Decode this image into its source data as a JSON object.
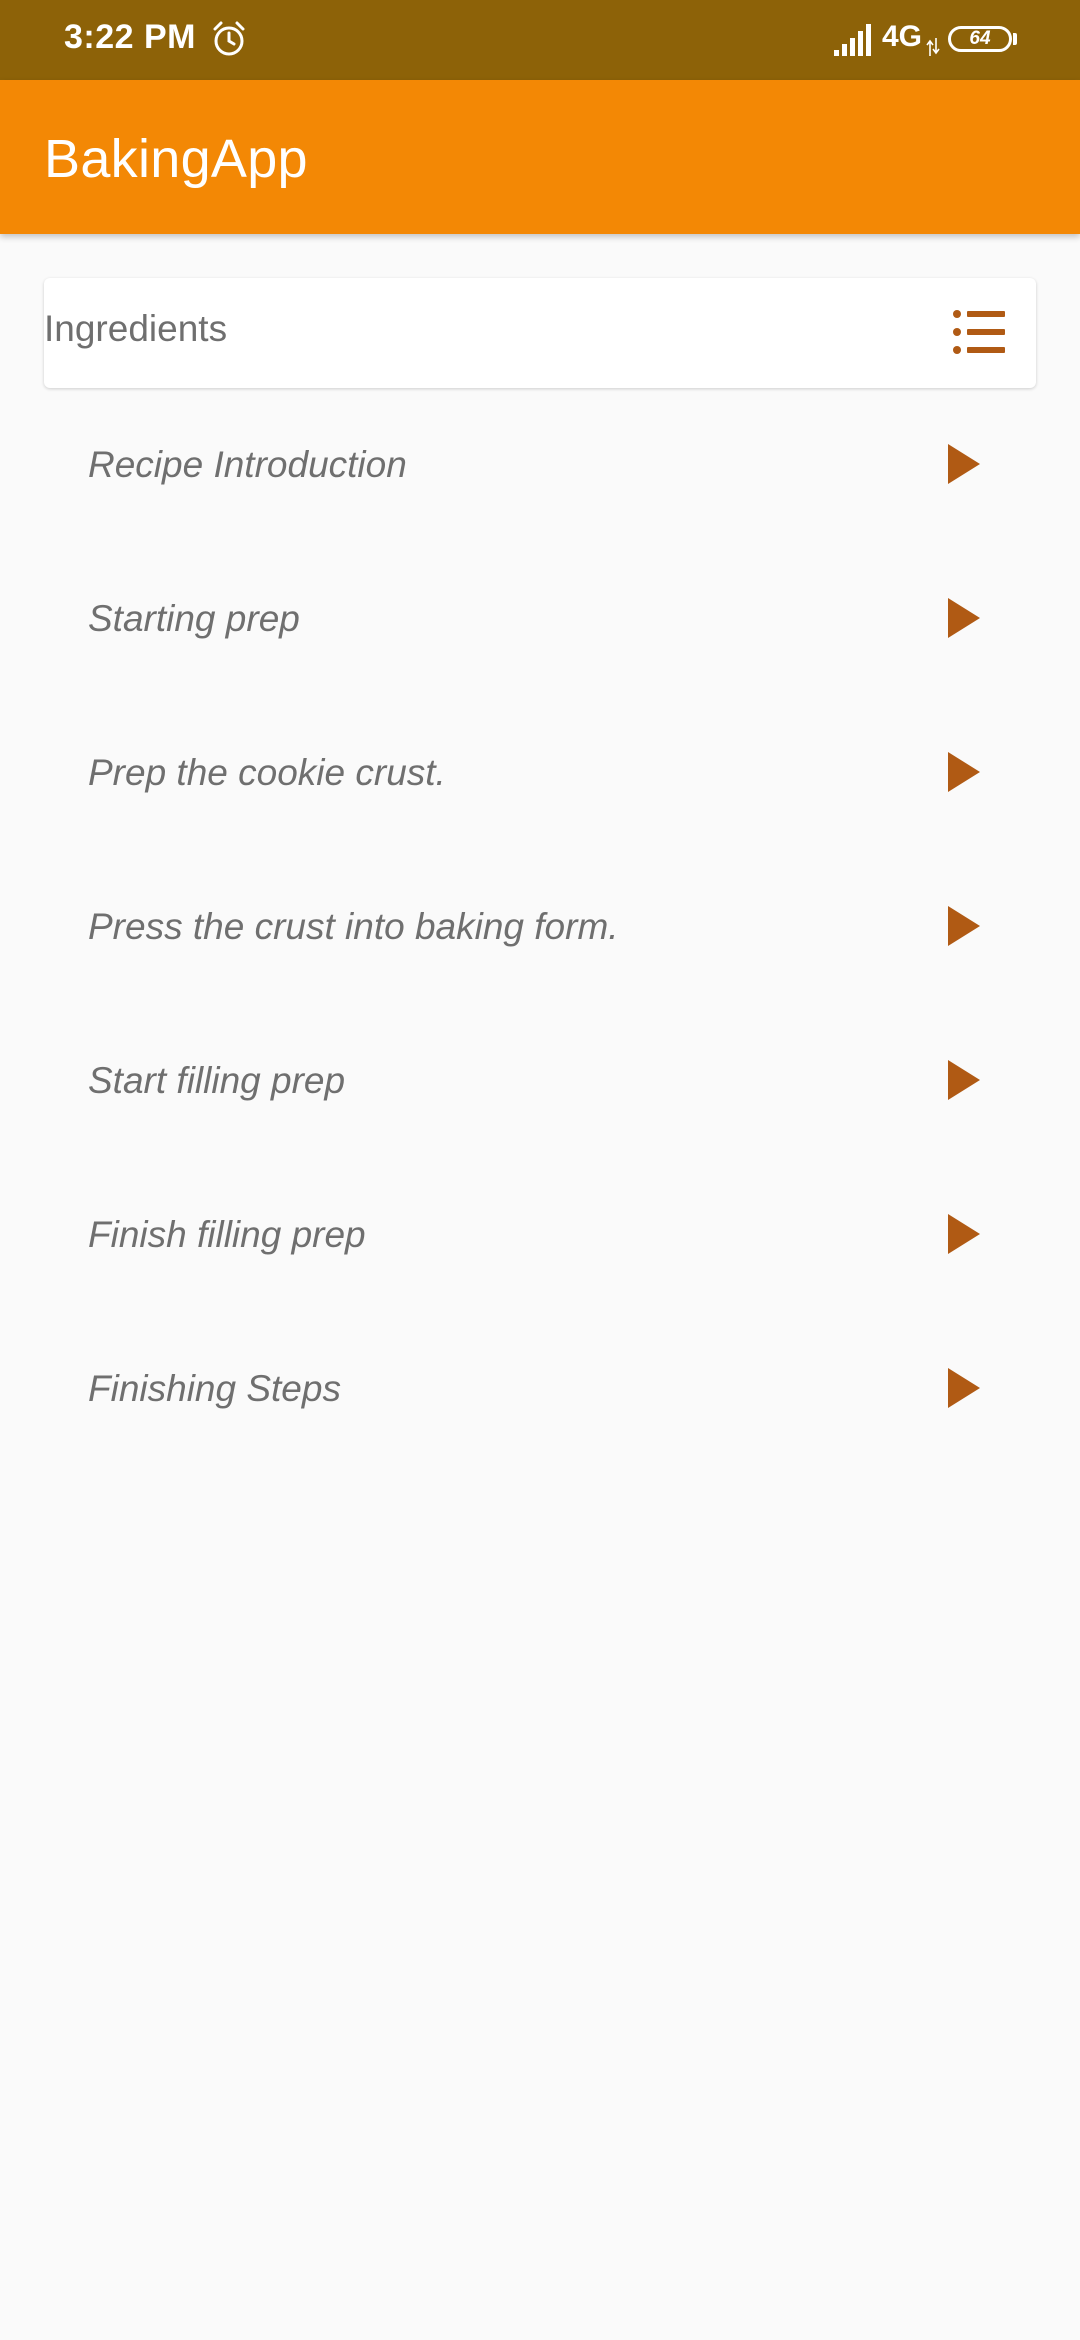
{
  "status_bar": {
    "time": "3:22 PM",
    "network": "4G",
    "battery": "64",
    "icons": [
      "alarm-icon",
      "signal-icon",
      "data-arrows-icon",
      "battery-icon"
    ]
  },
  "app_bar": {
    "title": "BakingApp"
  },
  "ingredients": {
    "label": "Ingredients",
    "icon": "list-icon"
  },
  "steps": [
    {
      "label": "Recipe Introduction",
      "icon": "play-icon"
    },
    {
      "label": "Starting prep",
      "icon": "play-icon"
    },
    {
      "label": "Prep the cookie crust.",
      "icon": "play-icon"
    },
    {
      "label": "Press the crust into baking form.",
      "icon": "play-icon"
    },
    {
      "label": "Start filling prep",
      "icon": "play-icon"
    },
    {
      "label": "Finish filling prep",
      "icon": "play-icon"
    },
    {
      "label": "Finishing Steps",
      "icon": "play-icon"
    }
  ],
  "colors": {
    "status_bar": "#8d6208",
    "app_bar": "#f38805",
    "accent_icon": "#b05a14",
    "text": "#6f6f6f",
    "background": "#fafafa"
  }
}
